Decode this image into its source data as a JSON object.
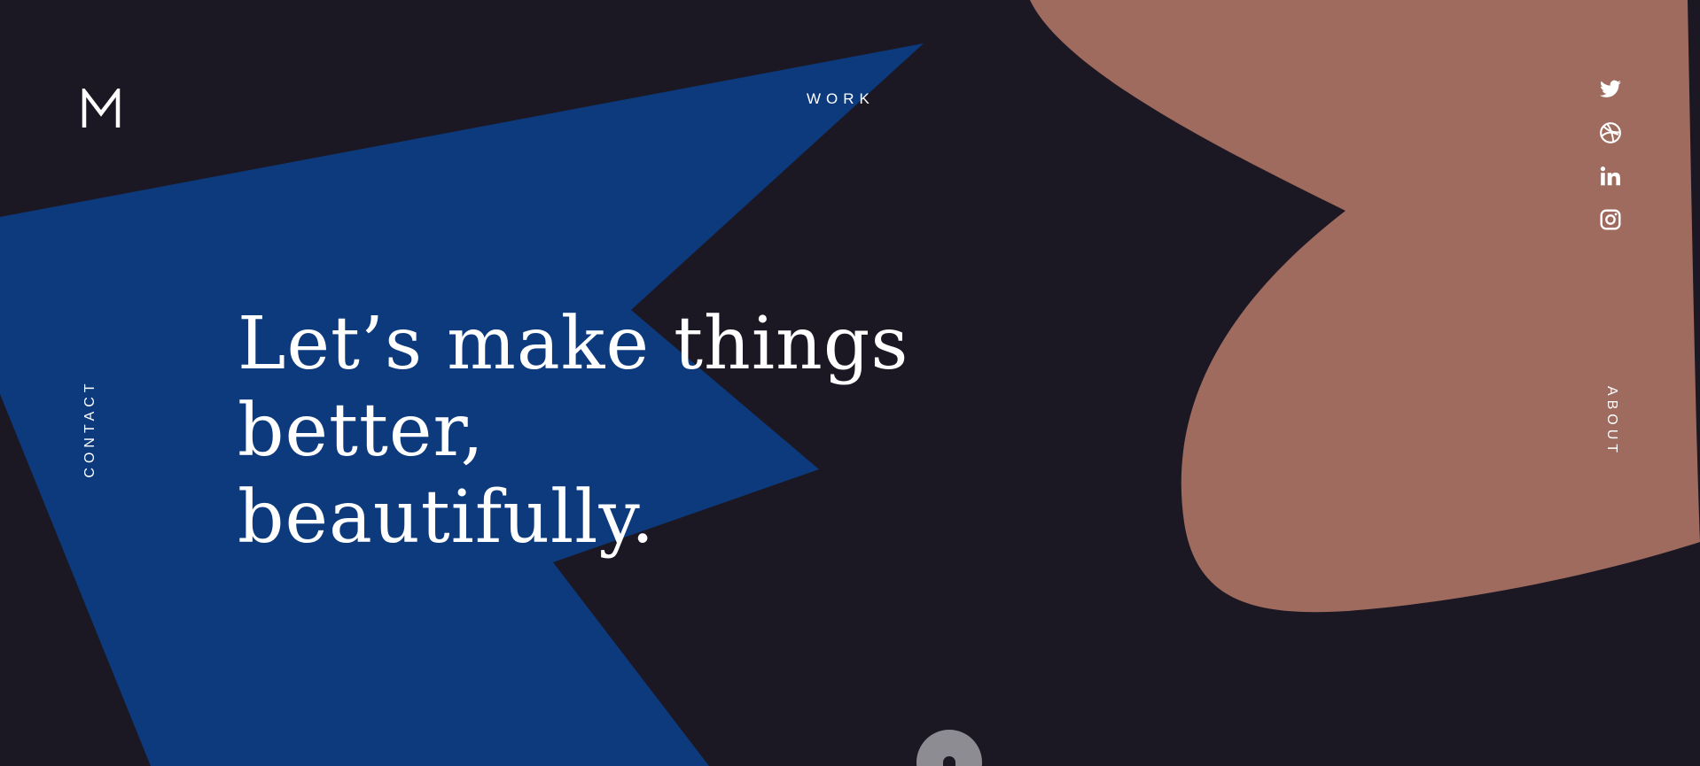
{
  "colors": {
    "background": "#1c1823",
    "blue_shape": "#0c3a7c",
    "clay_shape": "#9e6b5e",
    "text": "#ffffff",
    "scroll_indicator": "#8e8c93"
  },
  "brand": {
    "logo_letter": "M"
  },
  "nav": {
    "work": "WORK",
    "contact": "CONTACT",
    "about": "ABOUT"
  },
  "social": [
    {
      "icon": "twitter-icon"
    },
    {
      "icon": "dribbble-icon"
    },
    {
      "icon": "linkedin-icon"
    },
    {
      "icon": "instagram-icon"
    }
  ],
  "hero": {
    "line1": "Let’s make things better,",
    "line2": "beautifully."
  }
}
